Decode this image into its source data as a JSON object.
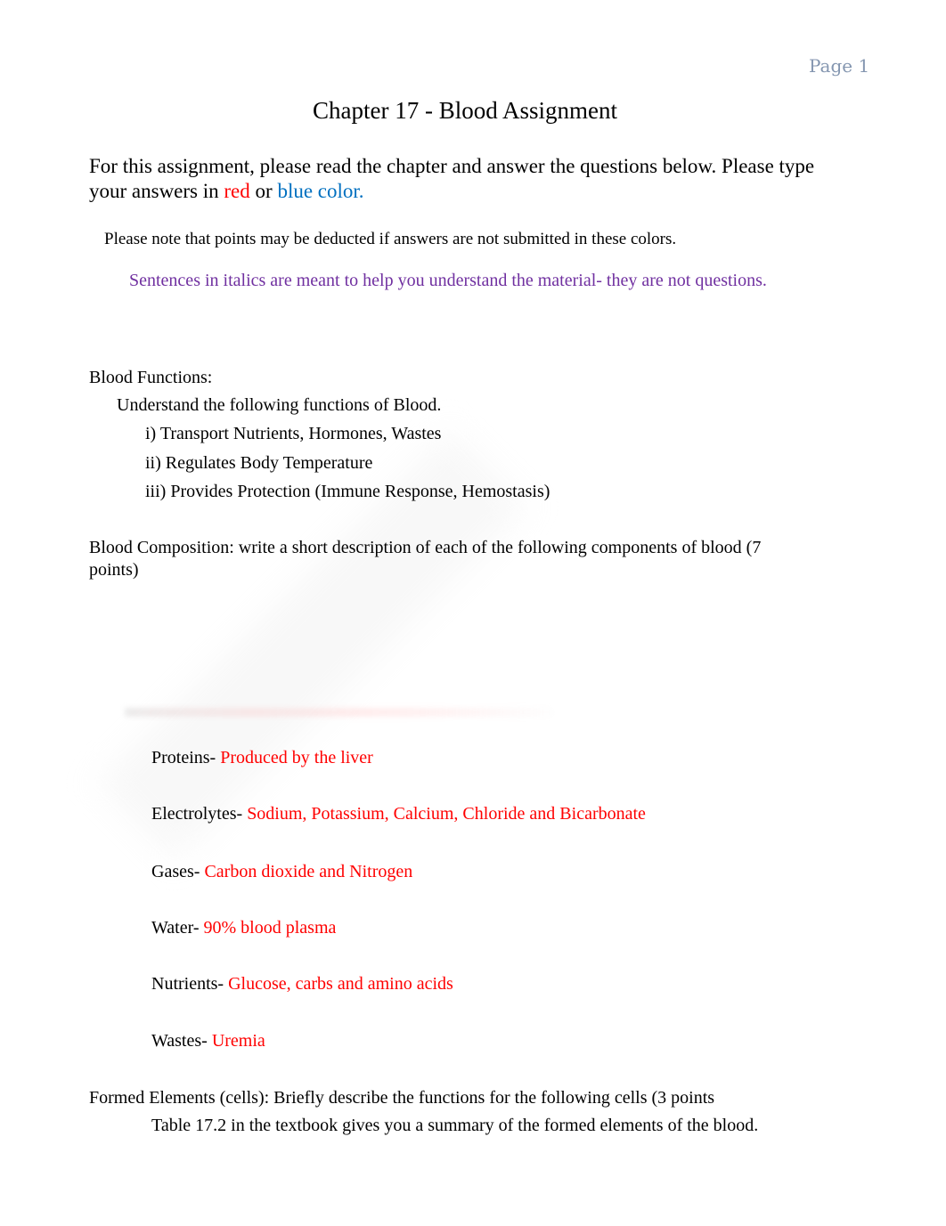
{
  "header": {
    "page_label": "Page 1"
  },
  "title": "Chapter 17 - Blood Assignment",
  "intro": {
    "text_before": "For this assignment, please read the chapter and answer the questions below. Please type your answers in ",
    "red_word": "red",
    "or_word": " or ",
    "blue_words": "blue color."
  },
  "note": "Please note that points may be deducted if answers are not submitted in these colors.",
  "italics_note": "Sentences in italics are meant to help you understand the material- they are not questions.",
  "blood_functions": {
    "heading": "Blood Functions:",
    "subheading": "Understand the following functions of Blood.",
    "items": [
      "i) Transport Nutrients, Hormones, Wastes",
      "ii) Regulates Body Temperature",
      "iii) Provides Protection (Immune Response, Hemostasis)"
    ]
  },
  "blood_composition": {
    "prompt_line1": "Blood Composition: write a short description of each of the following components of blood (7",
    "prompt_line2": "points)",
    "components": [
      {
        "label": "Proteins- ",
        "answer": "Produced by the liver"
      },
      {
        "label": "Electrolytes- ",
        "answer": "Sodium, Potassium, Calcium, Chloride and Bicarbonate"
      },
      {
        "label": "Gases- ",
        "answer": "Carbon dioxide and Nitrogen"
      },
      {
        "label": "Water- ",
        "answer": "90% blood plasma"
      },
      {
        "label": "Nutrients- ",
        "answer": "Glucose, carbs and amino acids"
      },
      {
        "label": "Wastes- ",
        "answer": "Uremia"
      }
    ]
  },
  "formed_elements": {
    "prompt": "Formed Elements (cells):  Briefly describe the functions for the following cells (3 points",
    "hint": "Table 17.2 in the textbook gives you a summary of the formed elements of the blood."
  },
  "colors": {
    "answer_red": "#ff0000",
    "blue": "#0070c0",
    "italic_purple": "#7030a0",
    "page_label": "#8496b0"
  }
}
